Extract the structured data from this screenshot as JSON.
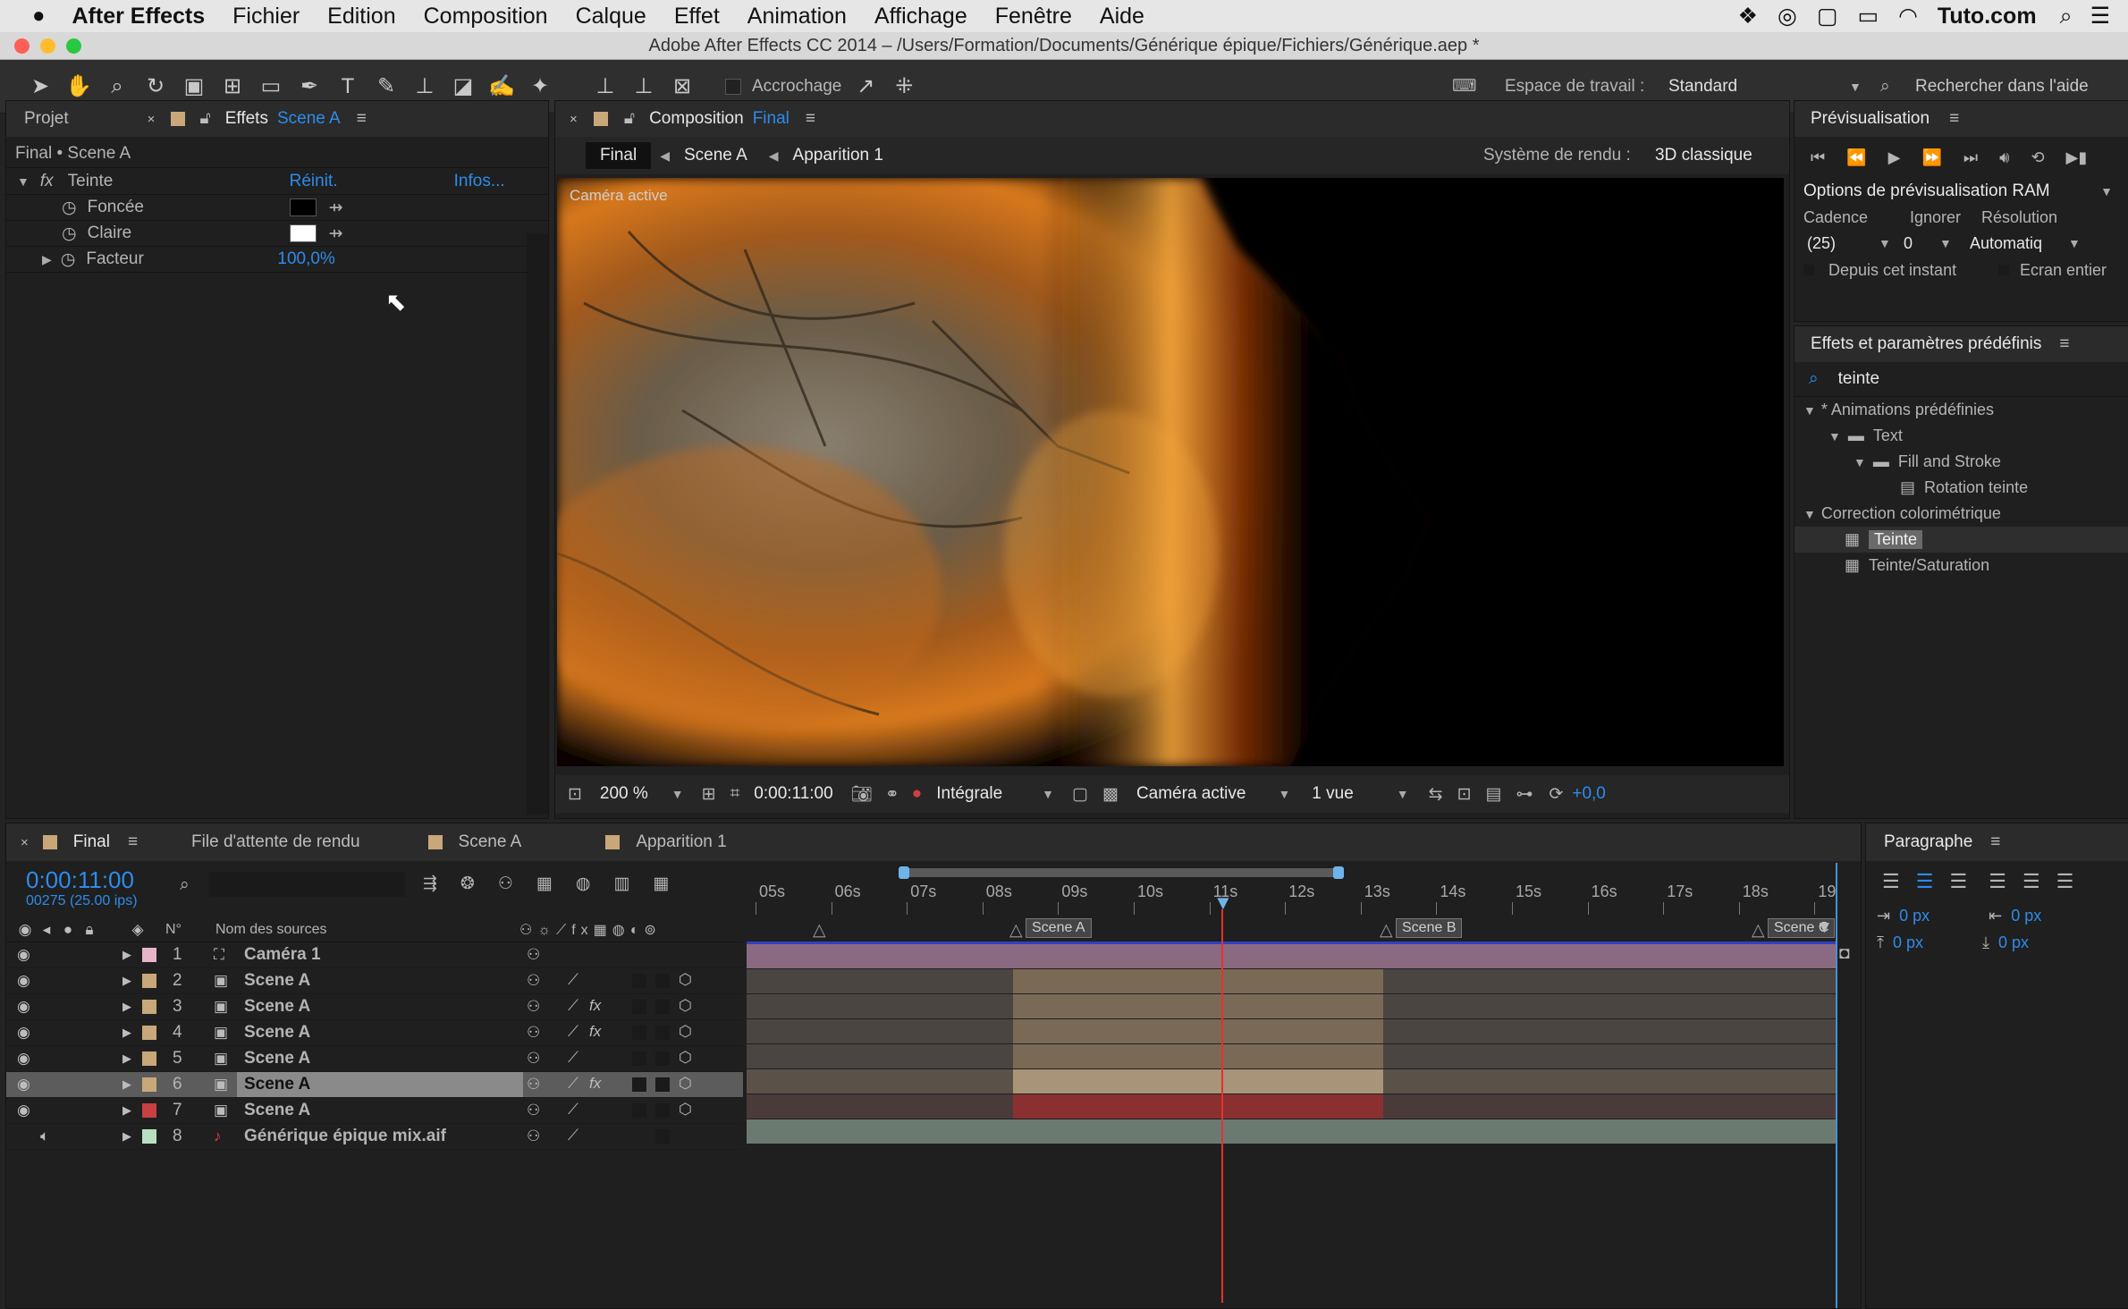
{
  "menubar": {
    "app": "After Effects",
    "items": [
      "Fichier",
      "Edition",
      "Composition",
      "Calque",
      "Effet",
      "Animation",
      "Affichage",
      "Fenêtre",
      "Aide"
    ],
    "right_label": "Tuto.com"
  },
  "window": {
    "title": "Adobe After Effects CC 2014 – /Users/Formation/Documents/Générique épique/Fichiers/Générique.aep *"
  },
  "toolbar": {
    "snapping_label": "Accrochage",
    "workspace_label": "Espace de travail :",
    "workspace_value": "Standard",
    "help_search_placeholder": "Rechercher dans l'aide"
  },
  "effects_panel": {
    "tab_project": "Projet",
    "tab_effects": "Effets",
    "tab_effects_target": "Scene A",
    "breadcrumb": "Final • Scene A",
    "effect_name": "Teinte",
    "reset": "Réinit.",
    "info": "Infos...",
    "params": [
      {
        "label": "Foncée",
        "color": "#000000"
      },
      {
        "label": "Claire",
        "color": "#ffffff"
      },
      {
        "label": "Facteur",
        "value": "100,0%"
      }
    ]
  },
  "comp_panel": {
    "tab_label": "Composition",
    "tab_target": "Final",
    "crumbs": [
      "Final",
      "Scene A",
      "Apparition 1"
    ],
    "renderer_label": "Système de rendu :",
    "renderer_value": "3D classique",
    "viewer_label": "Caméra active",
    "footer": {
      "zoom": "200 %",
      "time": "0:00:11:00",
      "resolution": "Intégrale",
      "camera": "Caméra active",
      "views": "1 vue",
      "exposure": "+0,0"
    }
  },
  "preview_panel": {
    "title": "Prévisualisation",
    "ram_options": "Options de prévisualisation RAM",
    "cadence_label": "Cadence",
    "ignore_label": "Ignorer",
    "resolution_label": "Résolution",
    "cadence_value": "(25)",
    "ignore_value": "0",
    "resolution_value": "Automatiq",
    "from_now": "Depuis cet instant",
    "fullscreen": "Ecran entier"
  },
  "presets_panel": {
    "title": "Effets et paramètres prédéfinis",
    "search_value": "teinte",
    "tree": [
      {
        "label": "* Animations prédéfinies",
        "depth": 0,
        "kind": "group"
      },
      {
        "label": "Text",
        "depth": 1,
        "kind": "folder"
      },
      {
        "label": "Fill and Stroke",
        "depth": 2,
        "kind": "folder"
      },
      {
        "label": "Rotation teinte",
        "depth": 3,
        "kind": "preset"
      },
      {
        "label": "Correction colorimétrique",
        "depth": 0,
        "kind": "group"
      },
      {
        "label": "Teinte",
        "depth": 1,
        "kind": "effect",
        "selected": true
      },
      {
        "label": "Teinte/Saturation",
        "depth": 1,
        "kind": "effect"
      }
    ]
  },
  "timeline": {
    "tabs": [
      "Final",
      "File d'attente de rendu",
      "Scene A",
      "Apparition 1"
    ],
    "current_time": "0:00:11:00",
    "current_frame": "00275 (25.00 ips)",
    "col_num": "N°",
    "col_name": "Nom des sources",
    "ticks": [
      "05s",
      "06s",
      "07s",
      "08s",
      "09s",
      "10s",
      "11s",
      "12s",
      "13s",
      "14s",
      "15s",
      "16s",
      "17s",
      "18s",
      "19"
    ],
    "markers": [
      "Scene A",
      "Scene B",
      "Scene C"
    ],
    "layers": [
      {
        "num": "1",
        "name": "Caméra 1",
        "color": "#e8b4c8",
        "kind": "camera"
      },
      {
        "num": "2",
        "name": "Scene A",
        "color": "#c8a878",
        "kind": "comp"
      },
      {
        "num": "3",
        "name": "Scene A",
        "color": "#c8a878",
        "kind": "comp",
        "fx": true
      },
      {
        "num": "4",
        "name": "Scene A",
        "color": "#c8a878",
        "kind": "comp",
        "fx": true
      },
      {
        "num": "5",
        "name": "Scene A",
        "color": "#c8a878",
        "kind": "comp"
      },
      {
        "num": "6",
        "name": "Scene A",
        "color": "#c8a878",
        "kind": "comp",
        "fx": true,
        "selected": true
      },
      {
        "num": "7",
        "name": "Scene A",
        "color": "#c84040",
        "kind": "comp"
      },
      {
        "num": "8",
        "name": "Générique épique mix.aif",
        "color": "#b8e0c0",
        "kind": "audio"
      }
    ]
  },
  "paragraph_panel": {
    "title": "Paragraphe",
    "indent_left": "0 px",
    "indent_right": "0 px",
    "space_before": "0 px",
    "space_after": "0 px"
  }
}
